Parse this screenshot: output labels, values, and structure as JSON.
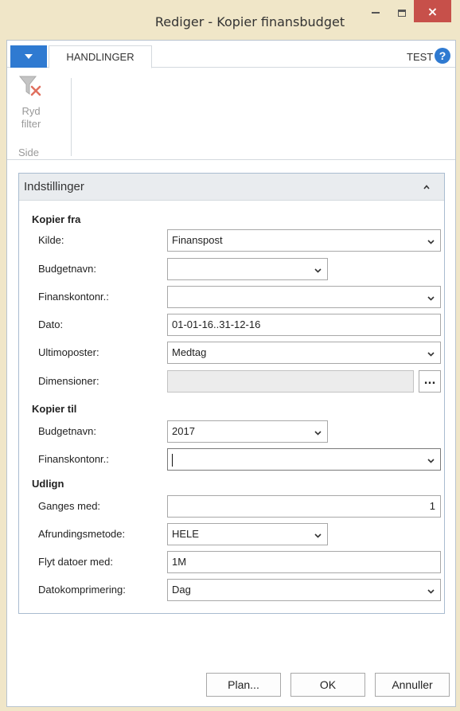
{
  "window": {
    "title": "Rediger - Kopier finansbudget",
    "close_glyph": "×"
  },
  "ribbon": {
    "tab_label": "HANDLINGER",
    "company": "TEST",
    "help_glyph": "?",
    "clear_filter_line1": "Ryd",
    "clear_filter_line2": "filter",
    "group_label": "Side"
  },
  "panel": {
    "title": "Indstillinger"
  },
  "copy_from": {
    "section_label": "Kopier fra",
    "source_label": "Kilde:",
    "source_value": "Finanspost",
    "budget_name_label": "Budgetnavn:",
    "budget_name_value": "",
    "gl_account_label": "Finanskontonr.:",
    "gl_account_value": "",
    "date_label": "Dato:",
    "date_value": "01-01-16..31-12-16",
    "closing_entries_label": "Ultimoposter:",
    "closing_entries_value": "Medtag",
    "dimensions_label": "Dimensioner:",
    "dimensions_value": "",
    "dimensions_button": "..."
  },
  "copy_to": {
    "section_label": "Kopier til",
    "budget_name_label": "Budgetnavn:",
    "budget_name_value": "2017",
    "gl_account_label": "Finanskontonr.:",
    "gl_account_value": ""
  },
  "apply": {
    "section_label": "Udlign",
    "multiply_label": "Ganges med:",
    "multiply_value": "1",
    "rounding_label": "Afrundingsmetode:",
    "rounding_value": "HELE",
    "date_change_label": "Flyt datoer med:",
    "date_change_value": "1M",
    "date_compression_label": "Datokomprimering:",
    "date_compression_value": "Dag"
  },
  "buttons": {
    "plan": "Plan...",
    "ok": "OK",
    "cancel": "Annuller"
  }
}
